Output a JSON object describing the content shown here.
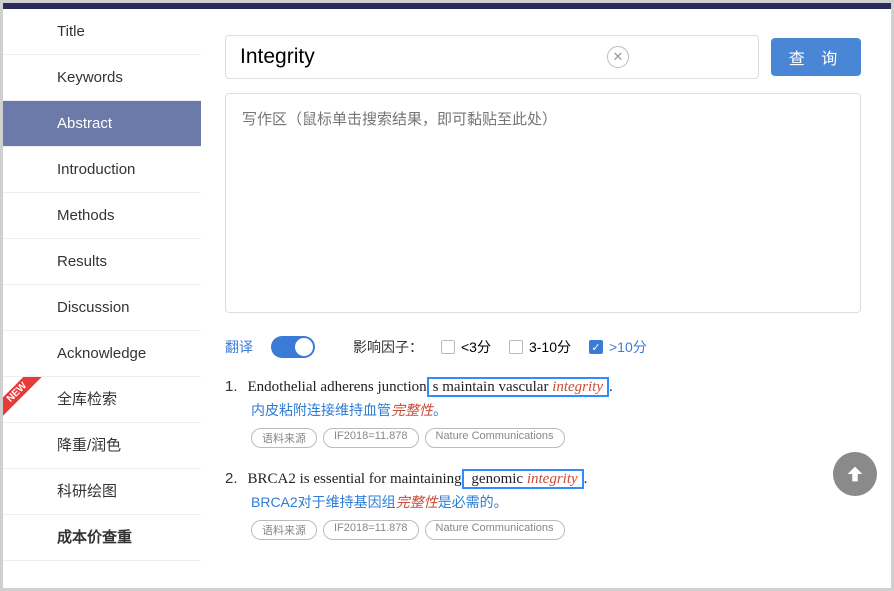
{
  "sidebar": {
    "items": [
      {
        "label": "Title"
      },
      {
        "label": "Keywords"
      },
      {
        "label": "Abstract"
      },
      {
        "label": "Introduction"
      },
      {
        "label": "Methods"
      },
      {
        "label": "Results"
      },
      {
        "label": "Discussion"
      },
      {
        "label": "Acknowledge"
      },
      {
        "label": "全库检索"
      },
      {
        "label": "降重/润色"
      },
      {
        "label": "科研绘图"
      },
      {
        "label": "成本价查重"
      }
    ],
    "new_badge": "NEW"
  },
  "search": {
    "value": "Integrity",
    "clear": "✕",
    "query_btn": "查 询"
  },
  "writing": {
    "placeholder": "写作区（鼠标单击搜索结果，即可黏贴至此处）"
  },
  "filters": {
    "translate_label": "翻译",
    "if_label": "影响因子：",
    "lt3": "<3分",
    "mid": "3-10分",
    "gt10": ">10分"
  },
  "results": [
    {
      "num": "1.",
      "en_pre": "Endothelial adherens junction",
      "en_boxed": "s maintain vascular ",
      "en_kw": "integrity",
      "en_post": ".",
      "cn_pre": "内皮粘附连接维持血管",
      "cn_kw": "完整性",
      "cn_post": "。",
      "tags": [
        "语料来源",
        "IF2018=11.878",
        "Nature Communications"
      ]
    },
    {
      "num": "2.",
      "en_pre": "BRCA2 is essential for maintaining",
      "en_boxed": " genomic ",
      "en_kw": "integrity",
      "en_post": ".",
      "cn_pre": "BRCA2对于维持基因组",
      "cn_kw": "完整性",
      "cn_post": "是必需的。",
      "tags": [
        "语料来源",
        "IF2018=11.878",
        "Nature Communications"
      ]
    }
  ]
}
